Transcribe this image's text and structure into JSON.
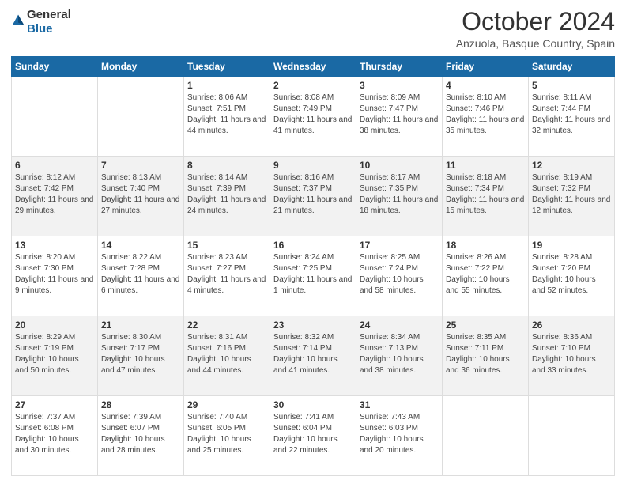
{
  "header": {
    "logo_general": "General",
    "logo_blue": "Blue",
    "month": "October 2024",
    "location": "Anzuola, Basque Country, Spain"
  },
  "weekdays": [
    "Sunday",
    "Monday",
    "Tuesday",
    "Wednesday",
    "Thursday",
    "Friday",
    "Saturday"
  ],
  "weeks": [
    [
      {
        "day": "",
        "info": ""
      },
      {
        "day": "",
        "info": ""
      },
      {
        "day": "1",
        "sunrise": "8:06 AM",
        "sunset": "7:51 PM",
        "daylight": "11 hours and 44 minutes."
      },
      {
        "day": "2",
        "sunrise": "8:08 AM",
        "sunset": "7:49 PM",
        "daylight": "11 hours and 41 minutes."
      },
      {
        "day": "3",
        "sunrise": "8:09 AM",
        "sunset": "7:47 PM",
        "daylight": "11 hours and 38 minutes."
      },
      {
        "day": "4",
        "sunrise": "8:10 AM",
        "sunset": "7:46 PM",
        "daylight": "11 hours and 35 minutes."
      },
      {
        "day": "5",
        "sunrise": "8:11 AM",
        "sunset": "7:44 PM",
        "daylight": "11 hours and 32 minutes."
      }
    ],
    [
      {
        "day": "6",
        "sunrise": "8:12 AM",
        "sunset": "7:42 PM",
        "daylight": "11 hours and 29 minutes."
      },
      {
        "day": "7",
        "sunrise": "8:13 AM",
        "sunset": "7:40 PM",
        "daylight": "11 hours and 27 minutes."
      },
      {
        "day": "8",
        "sunrise": "8:14 AM",
        "sunset": "7:39 PM",
        "daylight": "11 hours and 24 minutes."
      },
      {
        "day": "9",
        "sunrise": "8:16 AM",
        "sunset": "7:37 PM",
        "daylight": "11 hours and 21 minutes."
      },
      {
        "day": "10",
        "sunrise": "8:17 AM",
        "sunset": "7:35 PM",
        "daylight": "11 hours and 18 minutes."
      },
      {
        "day": "11",
        "sunrise": "8:18 AM",
        "sunset": "7:34 PM",
        "daylight": "11 hours and 15 minutes."
      },
      {
        "day": "12",
        "sunrise": "8:19 AM",
        "sunset": "7:32 PM",
        "daylight": "11 hours and 12 minutes."
      }
    ],
    [
      {
        "day": "13",
        "sunrise": "8:20 AM",
        "sunset": "7:30 PM",
        "daylight": "11 hours and 9 minutes."
      },
      {
        "day": "14",
        "sunrise": "8:22 AM",
        "sunset": "7:28 PM",
        "daylight": "11 hours and 6 minutes."
      },
      {
        "day": "15",
        "sunrise": "8:23 AM",
        "sunset": "7:27 PM",
        "daylight": "11 hours and 4 minutes."
      },
      {
        "day": "16",
        "sunrise": "8:24 AM",
        "sunset": "7:25 PM",
        "daylight": "11 hours and 1 minute."
      },
      {
        "day": "17",
        "sunrise": "8:25 AM",
        "sunset": "7:24 PM",
        "daylight": "10 hours and 58 minutes."
      },
      {
        "day": "18",
        "sunrise": "8:26 AM",
        "sunset": "7:22 PM",
        "daylight": "10 hours and 55 minutes."
      },
      {
        "day": "19",
        "sunrise": "8:28 AM",
        "sunset": "7:20 PM",
        "daylight": "10 hours and 52 minutes."
      }
    ],
    [
      {
        "day": "20",
        "sunrise": "8:29 AM",
        "sunset": "7:19 PM",
        "daylight": "10 hours and 50 minutes."
      },
      {
        "day": "21",
        "sunrise": "8:30 AM",
        "sunset": "7:17 PM",
        "daylight": "10 hours and 47 minutes."
      },
      {
        "day": "22",
        "sunrise": "8:31 AM",
        "sunset": "7:16 PM",
        "daylight": "10 hours and 44 minutes."
      },
      {
        "day": "23",
        "sunrise": "8:32 AM",
        "sunset": "7:14 PM",
        "daylight": "10 hours and 41 minutes."
      },
      {
        "day": "24",
        "sunrise": "8:34 AM",
        "sunset": "7:13 PM",
        "daylight": "10 hours and 38 minutes."
      },
      {
        "day": "25",
        "sunrise": "8:35 AM",
        "sunset": "7:11 PM",
        "daylight": "10 hours and 36 minutes."
      },
      {
        "day": "26",
        "sunrise": "8:36 AM",
        "sunset": "7:10 PM",
        "daylight": "10 hours and 33 minutes."
      }
    ],
    [
      {
        "day": "27",
        "sunrise": "7:37 AM",
        "sunset": "6:08 PM",
        "daylight": "10 hours and 30 minutes."
      },
      {
        "day": "28",
        "sunrise": "7:39 AM",
        "sunset": "6:07 PM",
        "daylight": "10 hours and 28 minutes."
      },
      {
        "day": "29",
        "sunrise": "7:40 AM",
        "sunset": "6:05 PM",
        "daylight": "10 hours and 25 minutes."
      },
      {
        "day": "30",
        "sunrise": "7:41 AM",
        "sunset": "6:04 PM",
        "daylight": "10 hours and 22 minutes."
      },
      {
        "day": "31",
        "sunrise": "7:43 AM",
        "sunset": "6:03 PM",
        "daylight": "10 hours and 20 minutes."
      },
      {
        "day": "",
        "info": ""
      },
      {
        "day": "",
        "info": ""
      }
    ]
  ]
}
